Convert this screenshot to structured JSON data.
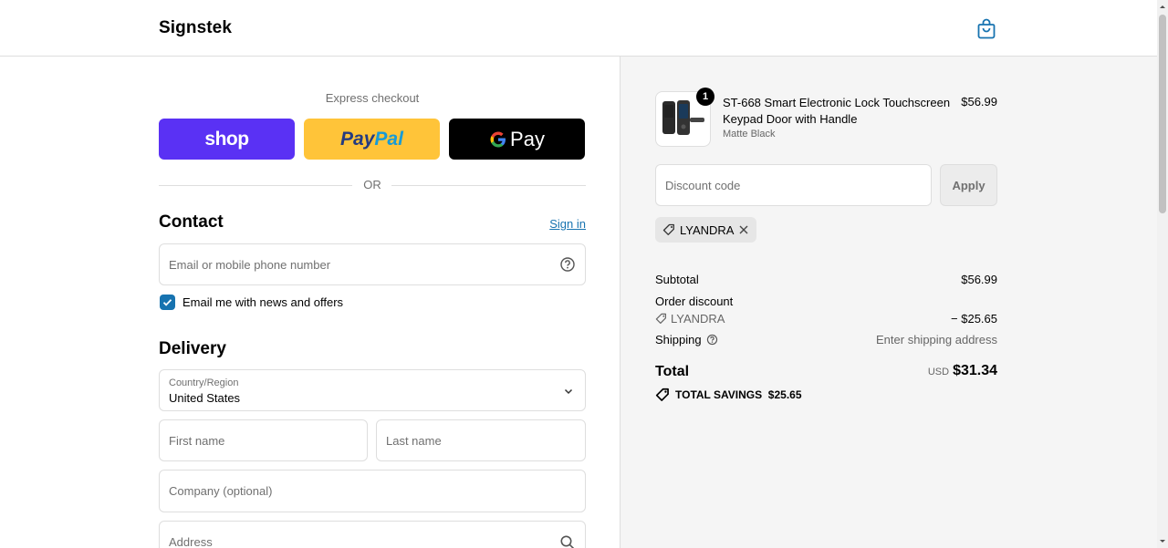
{
  "header": {
    "brand": "Signstek",
    "cart_icon": "shopping-bag-icon"
  },
  "express": {
    "title": "Express checkout",
    "shop_label": "shop",
    "paypal_label_1": "Pay",
    "paypal_label_2": "Pal",
    "gpay_g": "G",
    "gpay_label": "Pay",
    "or_label": "OR"
  },
  "contact": {
    "title": "Contact",
    "sign_in": "Sign in",
    "email_placeholder": "Email or mobile phone number",
    "newsletter_label": "Email me with news and offers",
    "newsletter_checked": true
  },
  "delivery": {
    "title": "Delivery",
    "country_label": "Country/Region",
    "country_value": "United States",
    "first_name_placeholder": "First name",
    "last_name_placeholder": "Last name",
    "company_placeholder": "Company (optional)",
    "address_placeholder": "Address"
  },
  "order": {
    "item": {
      "name": "ST-668 Smart Electronic Lock Touchscreen Keypad Door with Handle",
      "variant": "Matte Black",
      "price": "$56.99",
      "quantity": "1"
    },
    "discount_placeholder": "Discount code",
    "apply_label": "Apply",
    "applied_code": "LYANDRA",
    "subtotal_label": "Subtotal",
    "subtotal_value": "$56.99",
    "order_discount_label": "Order discount",
    "discount_code_label": "LYANDRA",
    "discount_value": "− $25.65",
    "shipping_label": "Shipping",
    "shipping_value": "Enter shipping address",
    "total_label": "Total",
    "total_currency": "USD",
    "total_value": "$31.34",
    "savings_label": "TOTAL SAVINGS",
    "savings_value": "$25.65"
  },
  "colors": {
    "shop": "#5a31f4",
    "paypal": "#ffc439",
    "accent": "#1773b0"
  }
}
